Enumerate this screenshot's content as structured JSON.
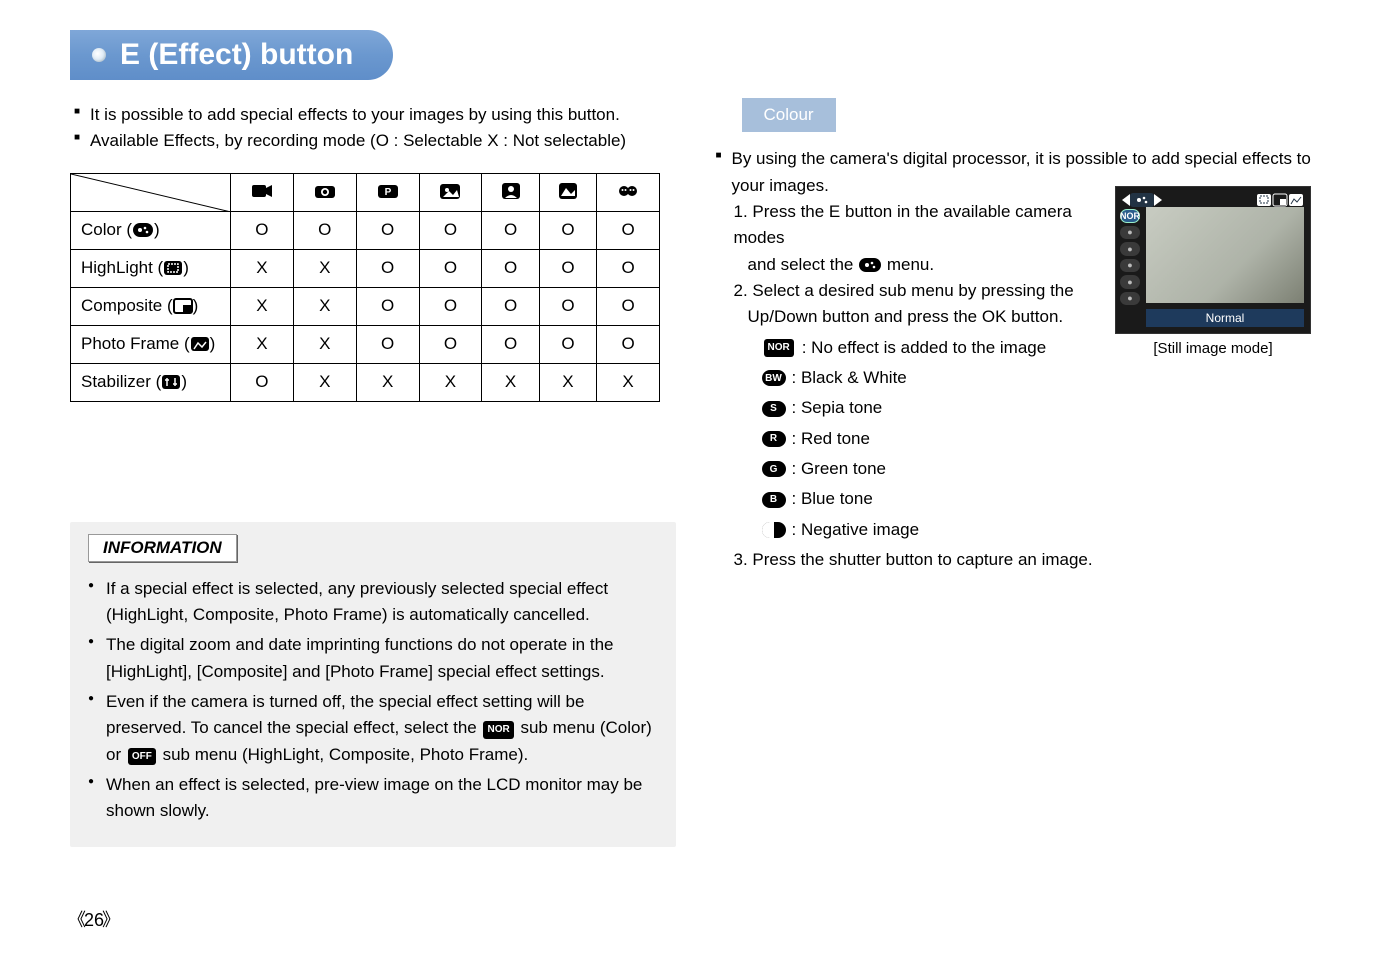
{
  "header": {
    "title": "E (Effect) button"
  },
  "intro": {
    "line1": "It is possible to add special effects to your images by using this button.",
    "line2": "Available Effects, by recording mode (O : Selectable X : Not selectable)"
  },
  "table": {
    "rows": [
      {
        "label": "Color (",
        "icon": "color",
        "cells": [
          "O",
          "O",
          "O",
          "O",
          "O",
          "O",
          "O"
        ]
      },
      {
        "label": "HighLight (",
        "icon": "highlight",
        "cells": [
          "X",
          "X",
          "O",
          "O",
          "O",
          "O",
          "O"
        ]
      },
      {
        "label": "Composite (",
        "icon": "composite",
        "cells": [
          "X",
          "X",
          "O",
          "O",
          "O",
          "O",
          "O"
        ]
      },
      {
        "label": "Photo Frame (",
        "icon": "frame",
        "cells": [
          "X",
          "X",
          "O",
          "O",
          "O",
          "O",
          "O"
        ]
      },
      {
        "label": "Stabilizer (",
        "icon": "stabilizer",
        "cells": [
          "O",
          "X",
          "X",
          "X",
          "X",
          "X",
          "X"
        ]
      }
    ],
    "label_close": ")"
  },
  "info": {
    "title": "INFORMATION",
    "items": [
      "If a special effect is selected, any previously selected special effect (HighLight, Composite, Photo Frame) is automatically cancelled.",
      "The digital zoom and date imprinting functions do not operate in the [HighLight], [Composite] and [Photo Frame] special effect settings.",
      "Even if the camera is turned off, the special effect setting will be preserved. To cancel the special effect, select the NOR sub menu (Color) or OFF sub menu (HighLight, Composite, Photo Frame).",
      "When an effect is selected, pre-view image on the LCD monitor may be shown slowly."
    ]
  },
  "colour": {
    "header": "Colour",
    "lead": "By using the camera's digital processor, it is possible to add special effects to your images.",
    "step1a": "1. Press the E button in the available camera modes",
    "step1b": "and select the",
    "step1c": "menu.",
    "step2a": "2. Select a desired sub menu by pressing the",
    "step2b": "Up/Down button and press the OK button.",
    "effects": [
      {
        "chip": "NOR",
        "text": ": No effect is added to the image"
      },
      {
        "chip": "BW",
        "text": ": Black & White"
      },
      {
        "chip": "S",
        "text": ": Sepia tone"
      },
      {
        "chip": "R",
        "text": ": Red tone"
      },
      {
        "chip": "G",
        "text": ": Green tone"
      },
      {
        "chip": "B",
        "text": ": Blue tone"
      },
      {
        "chip": "NEG",
        "text": ": Negative image"
      }
    ],
    "step3": "3. Press the shutter button to capture an image."
  },
  "screen": {
    "normal": "Normal",
    "caption": "[Still image mode]"
  },
  "page": "26"
}
